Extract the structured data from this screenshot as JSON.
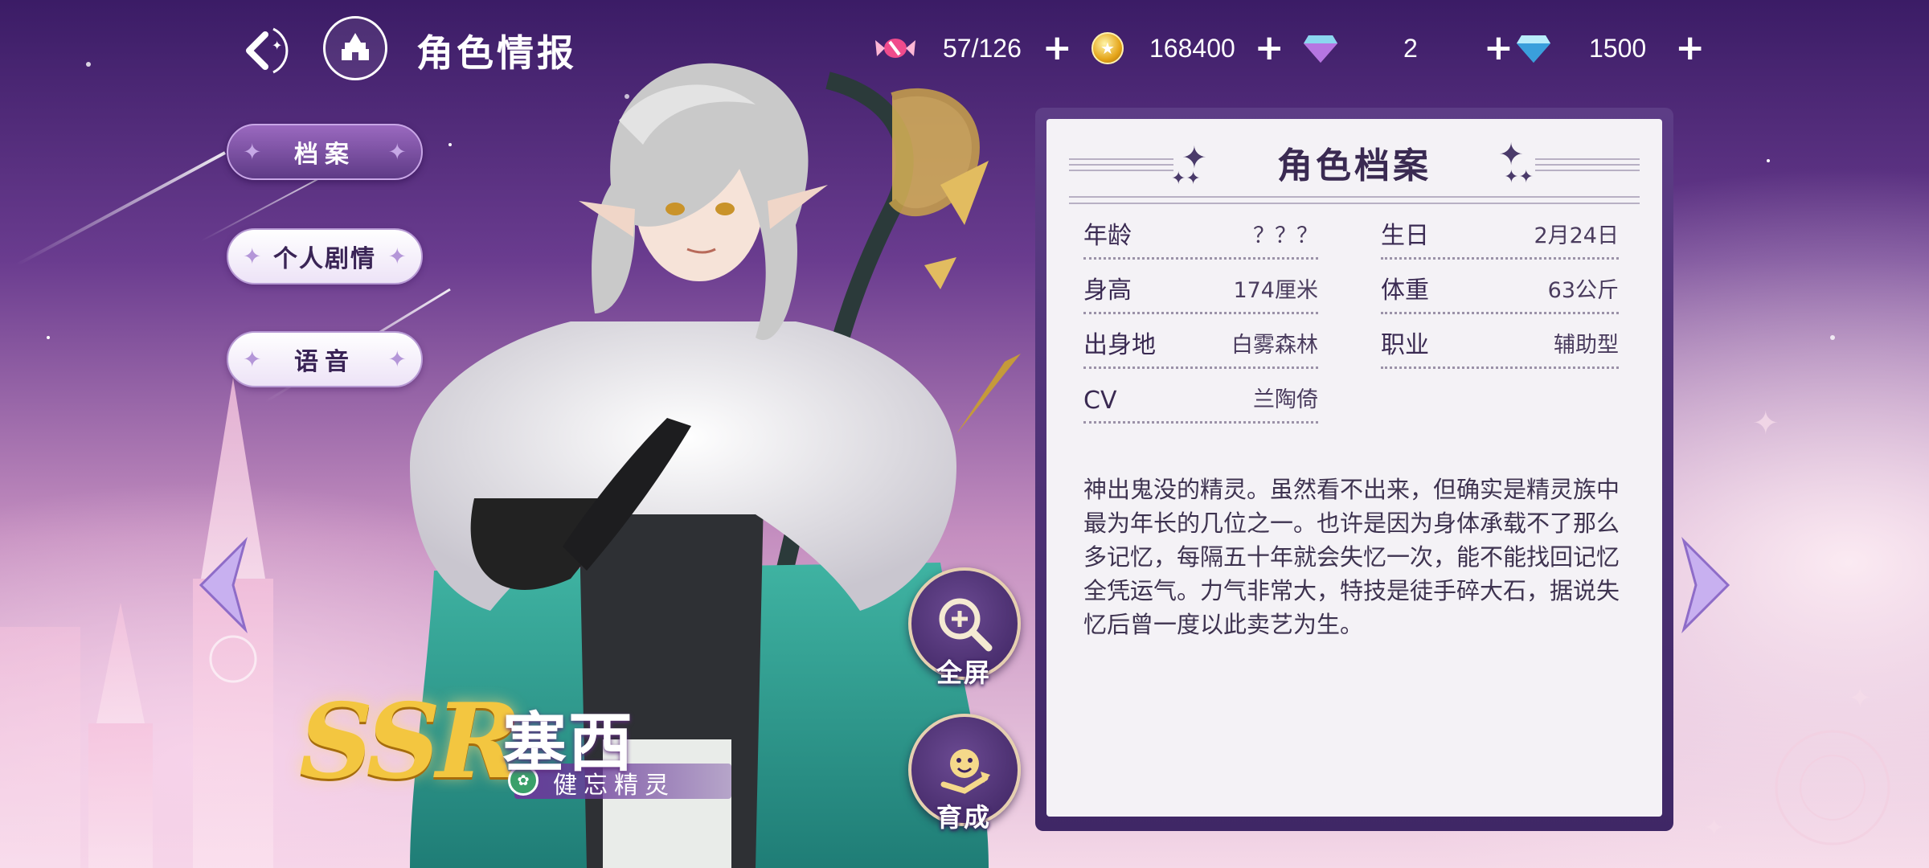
{
  "header": {
    "title": "角色情报",
    "stamina": "57/126",
    "gold": "168400",
    "gem_a": "2",
    "gem_b": "1500",
    "plus_symbol": "+"
  },
  "menu": {
    "items": [
      {
        "label": "档案",
        "active": true
      },
      {
        "label": "个人剧情",
        "active": false
      },
      {
        "label": "语音",
        "active": false
      }
    ]
  },
  "character": {
    "rarity": "SSR",
    "name": "塞西",
    "subtitle": "健忘精灵"
  },
  "actions": {
    "fullscreen": "全屏",
    "develop": "育成"
  },
  "profile": {
    "title": "角色档案",
    "fields": [
      {
        "label": "年龄",
        "value": "？？？"
      },
      {
        "label": "生日",
        "value": "2月24日"
      },
      {
        "label": "身高",
        "value": "174厘米"
      },
      {
        "label": "体重",
        "value": "63公斤"
      },
      {
        "label": "出身地",
        "value": "白雾森林"
      },
      {
        "label": "职业",
        "value": "辅助型"
      },
      {
        "label": "CV",
        "value": "兰陶倚"
      }
    ],
    "description": "神出鬼没的精灵。虽然看不出来，但确实是精灵族中最为年长的几位之一。也许是因为身体承载不了那么多记忆，每隔五十年就会失忆一次，能不能找回记忆全凭运气。力气非常大，特技是徒手碎大石，据说失忆后曾一度以此卖艺为生。"
  },
  "colors": {
    "accent_purple": "#5e3a86",
    "panel_bg": "#f4f2f6",
    "ssr_gold": "#f3c640"
  },
  "icons": [
    "back-icon",
    "home-castle-icon",
    "candy-icon",
    "gold-coin-icon",
    "pink-gem-icon",
    "blue-gem-icon",
    "zoom-icon",
    "develop-icon",
    "arrow-left-icon",
    "arrow-right-icon"
  ]
}
